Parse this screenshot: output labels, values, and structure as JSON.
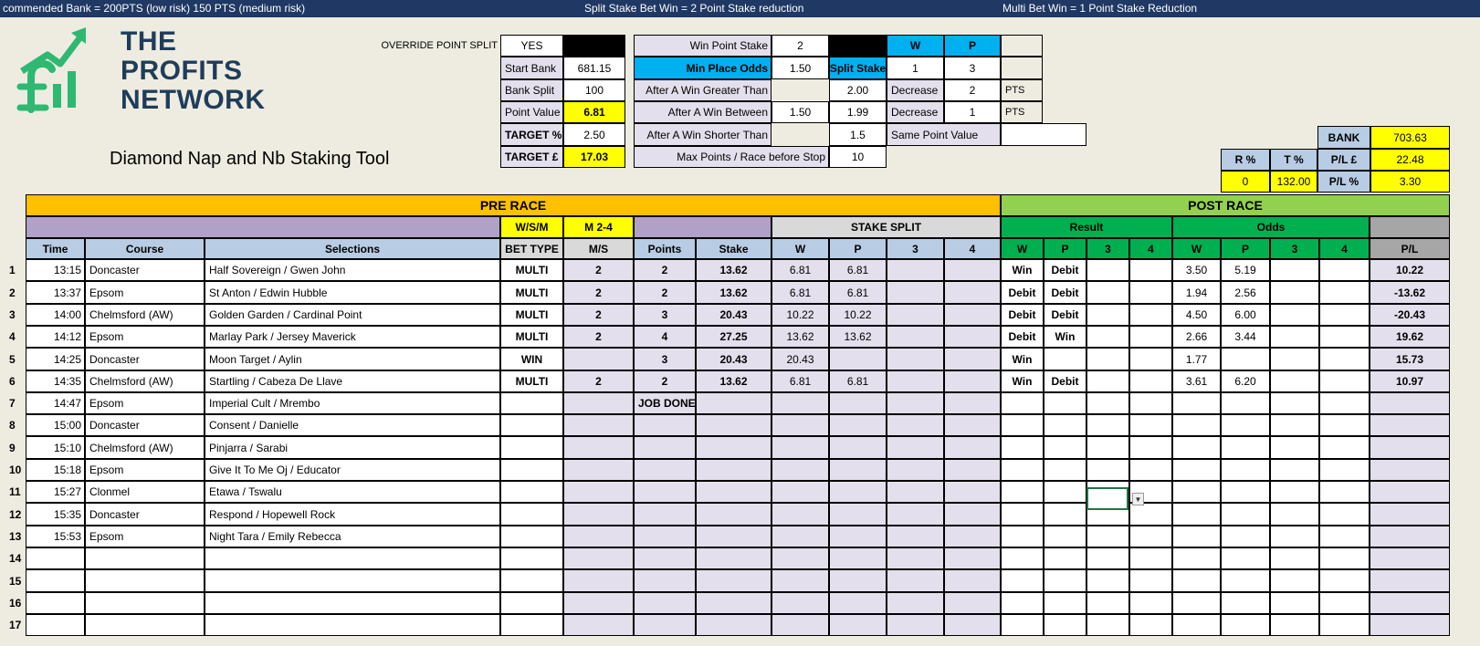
{
  "topbar": {
    "left": "commended Bank = 200PTS (low risk) 150 PTS (medium risk)",
    "center": "Split Stake Bet Win = 2 Point Stake reduction",
    "right": "Multi Bet Win = 1 Point  Stake Reduction"
  },
  "logo": {
    "line1": "THE",
    "line2": "PROFITS",
    "line3": "NETWORK"
  },
  "title": "Diamond Nap and Nb Staking Tool",
  "settings": {
    "override_label": "OVERRIDE POINT SPLIT",
    "override_value": "YES",
    "start_bank_label": "Start Bank",
    "start_bank": "681.15",
    "bank_split_label": "Bank Split",
    "bank_split": "100",
    "point_value_label": "Point Value",
    "point_value": "6.81",
    "target_pct_label": "TARGET %",
    "target_pct": "2.50",
    "target_gbp_label": "TARGET £",
    "target_gbp": "17.03",
    "win_point_stake_label": "Win Point Stake",
    "win_point_stake": "2",
    "min_place_odds_label": "Min Place Odds",
    "min_place_odds": "1.50",
    "after_win_greater_label": "After A Win Greater Than",
    "after_win_greater": "2.00",
    "after_win_between_label": "After A Win Between",
    "after_win_between_a": "1.50",
    "after_win_between_b": "1.99",
    "after_win_shorter_label": "After A Win Shorter Than",
    "after_win_shorter": "1.5",
    "max_points_label": "Max Points / Race before Stop",
    "max_points": "10",
    "split_stake_label": "Split Stake",
    "w_label": "W",
    "p_label": "P",
    "split_w": "1",
    "split_p": "3",
    "decrease_label": "Decrease",
    "decrease_1": "2",
    "decrease_2": "1",
    "pts_label": "PTS",
    "same_point_label": "Same Point Value"
  },
  "summary": {
    "bank_label": "BANK",
    "bank": "703.63",
    "r_pct_label": "R %",
    "t_pct_label": "T %",
    "pl_gbp_label": "P/L  £",
    "pl_gbp": "22.48",
    "r_pct": "0",
    "t_pct": "132.00",
    "pl_pct_label": "P/L %",
    "pl_pct": "3.30"
  },
  "headers": {
    "pre_race": "PRE RACE",
    "post_race": "POST RACE",
    "wsm": "W/S/M",
    "m24": "M 2-4",
    "stake_split": "STAKE SPLIT",
    "result": "Result",
    "odds": "Odds",
    "time": "Time",
    "course": "Course",
    "selections": "Selections",
    "bet_type": "BET TYPE",
    "ms": "M/S",
    "points": "Points",
    "stake": "Stake",
    "w": "W",
    "p": "P",
    "c3": "3",
    "c4": "4",
    "pl": "P/L"
  },
  "rows": [
    {
      "n": "1",
      "time": "13:15",
      "course": "Doncaster",
      "sel": "Half Sovereign / Gwen John",
      "bet": "MULTI",
      "ms": "2",
      "pts": "2",
      "stake": "13.62",
      "sw": "6.81",
      "sp": "6.81",
      "rw": "Win",
      "rp": "Debit",
      "ow": "3.50",
      "op": "5.19",
      "pl": "10.22"
    },
    {
      "n": "2",
      "time": "13:37",
      "course": "Epsom",
      "sel": "St Anton / Edwin Hubble",
      "bet": "MULTI",
      "ms": "2",
      "pts": "2",
      "stake": "13.62",
      "sw": "6.81",
      "sp": "6.81",
      "rw": "Debit",
      "rp": "Debit",
      "ow": "1.94",
      "op": "2.56",
      "pl": "-13.62"
    },
    {
      "n": "3",
      "time": "14:00",
      "course": "Chelmsford (AW)",
      "sel": "Golden Garden / Cardinal Point",
      "bet": "MULTI",
      "ms": "2",
      "pts": "3",
      "stake": "20.43",
      "sw": "10.22",
      "sp": "10.22",
      "rw": "Debit",
      "rp": "Debit",
      "ow": "4.50",
      "op": "6.00",
      "pl": "-20.43"
    },
    {
      "n": "4",
      "time": "14:12",
      "course": "Epsom",
      "sel": "Marlay Park / Jersey Maverick",
      "bet": "MULTI",
      "ms": "2",
      "pts": "4",
      "stake": "27.25",
      "sw": "13.62",
      "sp": "13.62",
      "rw": "Debit",
      "rp": "Win",
      "ow": "2.66",
      "op": "3.44",
      "pl": "19.62"
    },
    {
      "n": "5",
      "time": "14:25",
      "course": "Doncaster",
      "sel": "Moon Target / Aylin",
      "bet": "WIN",
      "ms": "",
      "pts": "3",
      "stake": "20.43",
      "sw": "20.43",
      "sp": "",
      "rw": "Win",
      "rp": "",
      "ow": "1.77",
      "op": "",
      "pl": "15.73"
    },
    {
      "n": "6",
      "time": "14:35",
      "course": "Chelmsford (AW)",
      "sel": "Startling / Cabeza De Llave",
      "bet": "MULTI",
      "ms": "2",
      "pts": "2",
      "stake": "13.62",
      "sw": "6.81",
      "sp": "6.81",
      "rw": "Win",
      "rp": "Debit",
      "ow": "3.61",
      "op": "6.20",
      "pl": "10.97"
    },
    {
      "n": "7",
      "time": "14:47",
      "course": "Epsom",
      "sel": "Imperial Cult / Mrembo",
      "bet": "",
      "ms": "",
      "pts": "JOB DONE",
      "stake": "",
      "sw": "",
      "sp": "",
      "rw": "",
      "rp": "",
      "ow": "",
      "op": "",
      "pl": ""
    },
    {
      "n": "8",
      "time": "15:00",
      "course": "Doncaster",
      "sel": "Consent / Danielle",
      "bet": "",
      "ms": "",
      "pts": "",
      "stake": "",
      "sw": "",
      "sp": "",
      "rw": "",
      "rp": "",
      "ow": "",
      "op": "",
      "pl": ""
    },
    {
      "n": "9",
      "time": "15:10",
      "course": "Chelmsford (AW)",
      "sel": "Pinjarra / Sarabi",
      "bet": "",
      "ms": "",
      "pts": "",
      "stake": "",
      "sw": "",
      "sp": "",
      "rw": "",
      "rp": "",
      "ow": "",
      "op": "",
      "pl": ""
    },
    {
      "n": "10",
      "time": "15:18",
      "course": "Epsom",
      "sel": "Give It To Me Oj / Educator",
      "bet": "",
      "ms": "",
      "pts": "",
      "stake": "",
      "sw": "",
      "sp": "",
      "rw": "",
      "rp": "",
      "ow": "",
      "op": "",
      "pl": ""
    },
    {
      "n": "11",
      "time": "15:27",
      "course": "Clonmel",
      "sel": "Etawa / Tswalu",
      "bet": "",
      "ms": "",
      "pts": "",
      "stake": "",
      "sw": "",
      "sp": "",
      "rw": "",
      "rp": "",
      "ow": "",
      "op": "",
      "pl": ""
    },
    {
      "n": "12",
      "time": "15:35",
      "course": "Doncaster",
      "sel": "Respond / Hopewell Rock",
      "bet": "",
      "ms": "",
      "pts": "",
      "stake": "",
      "sw": "",
      "sp": "",
      "rw": "",
      "rp": "",
      "ow": "",
      "op": "",
      "pl": ""
    },
    {
      "n": "13",
      "time": "15:53",
      "course": "Epsom",
      "sel": "Night Tara / Emily Rebecca",
      "bet": "",
      "ms": "",
      "pts": "",
      "stake": "",
      "sw": "",
      "sp": "",
      "rw": "",
      "rp": "",
      "ow": "",
      "op": "",
      "pl": ""
    },
    {
      "n": "14",
      "time": "",
      "course": "",
      "sel": "",
      "bet": "",
      "ms": "",
      "pts": "",
      "stake": "",
      "sw": "",
      "sp": "",
      "rw": "",
      "rp": "",
      "ow": "",
      "op": "",
      "pl": ""
    },
    {
      "n": "15",
      "time": "",
      "course": "",
      "sel": "",
      "bet": "",
      "ms": "",
      "pts": "",
      "stake": "",
      "sw": "",
      "sp": "",
      "rw": "",
      "rp": "",
      "ow": "",
      "op": "",
      "pl": ""
    },
    {
      "n": "16",
      "time": "",
      "course": "",
      "sel": "",
      "bet": "",
      "ms": "",
      "pts": "",
      "stake": "",
      "sw": "",
      "sp": "",
      "rw": "",
      "rp": "",
      "ow": "",
      "op": "",
      "pl": ""
    },
    {
      "n": "17",
      "time": "",
      "course": "",
      "sel": "",
      "bet": "",
      "ms": "",
      "pts": "",
      "stake": "",
      "sw": "",
      "sp": "",
      "rw": "",
      "rp": "",
      "ow": "",
      "op": "",
      "pl": ""
    }
  ]
}
